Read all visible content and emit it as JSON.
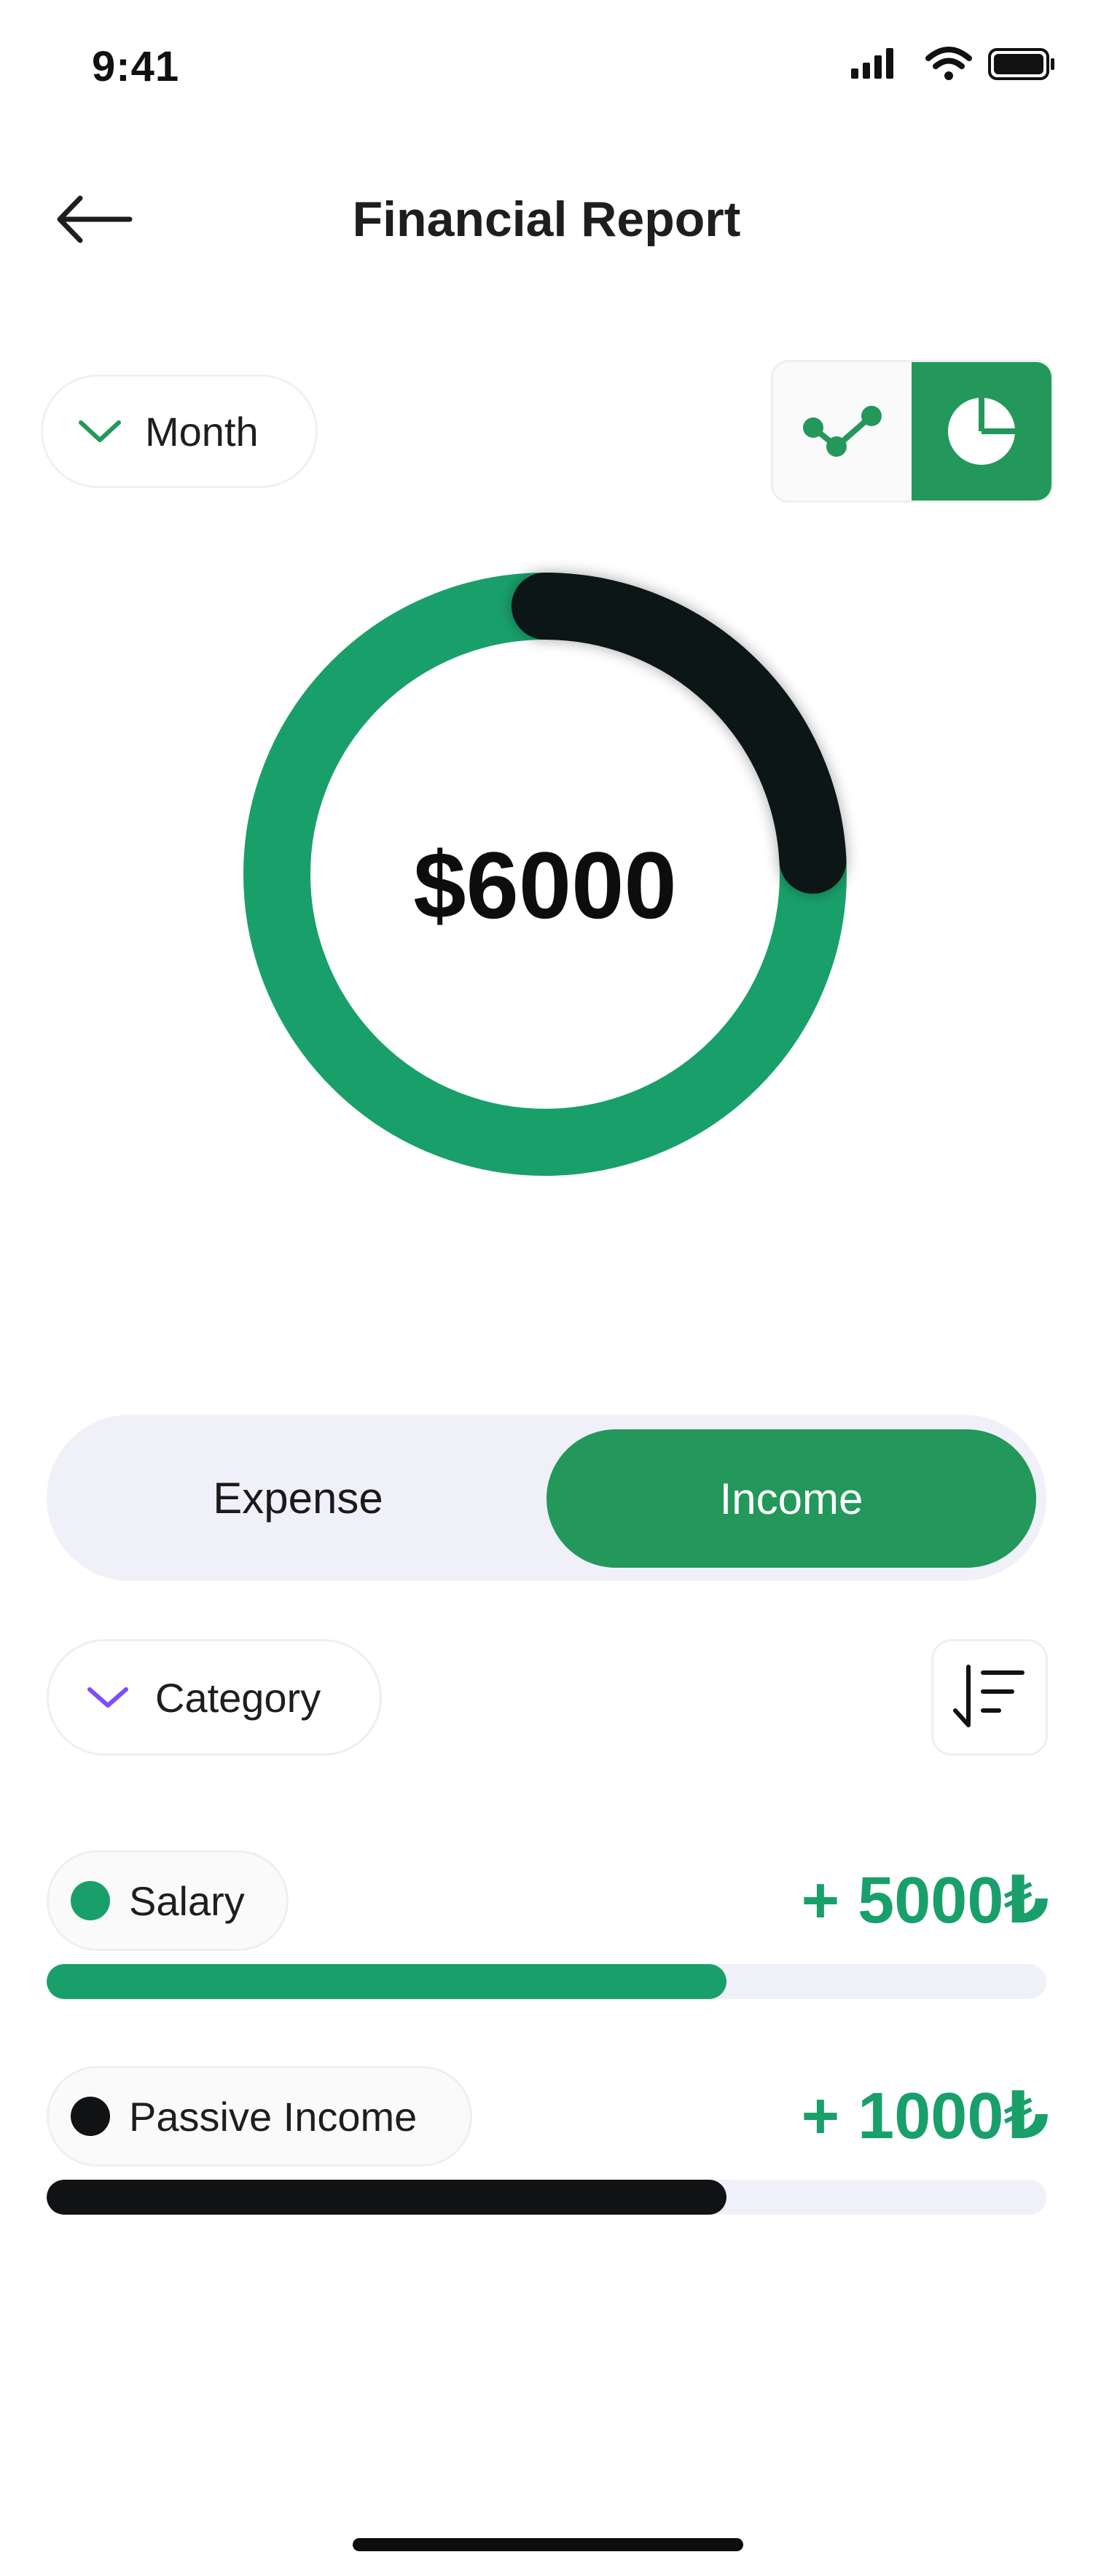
{
  "status_bar": {
    "time": "9:41"
  },
  "header": {
    "title": "Financial Report"
  },
  "filters": {
    "period_label": "Month",
    "category_label": "Category"
  },
  "chart_toggle": {
    "options": [
      "line-chart",
      "pie-chart"
    ],
    "selected": "pie-chart"
  },
  "chart_data": {
    "type": "pie",
    "total_label": "$6000",
    "slices": [
      {
        "name": "Salary",
        "value": 5000,
        "color": "#19a06a"
      },
      {
        "name": "Passive Income",
        "value": 1000,
        "color": "#111214"
      }
    ]
  },
  "segmented": {
    "expense_label": "Expense",
    "income_label": "Income",
    "selected": "Income"
  },
  "categories": [
    {
      "label": "Salary",
      "amount": "+ 5000₺",
      "color": "#19a06a",
      "progress": 0.68
    },
    {
      "label": "Passive Income",
      "amount": "+ 1000₺",
      "color": "#111214",
      "progress": 0.68
    }
  ],
  "colors": {
    "accent": "#23985a",
    "income_green": "#19a06a",
    "dark": "#111214"
  }
}
